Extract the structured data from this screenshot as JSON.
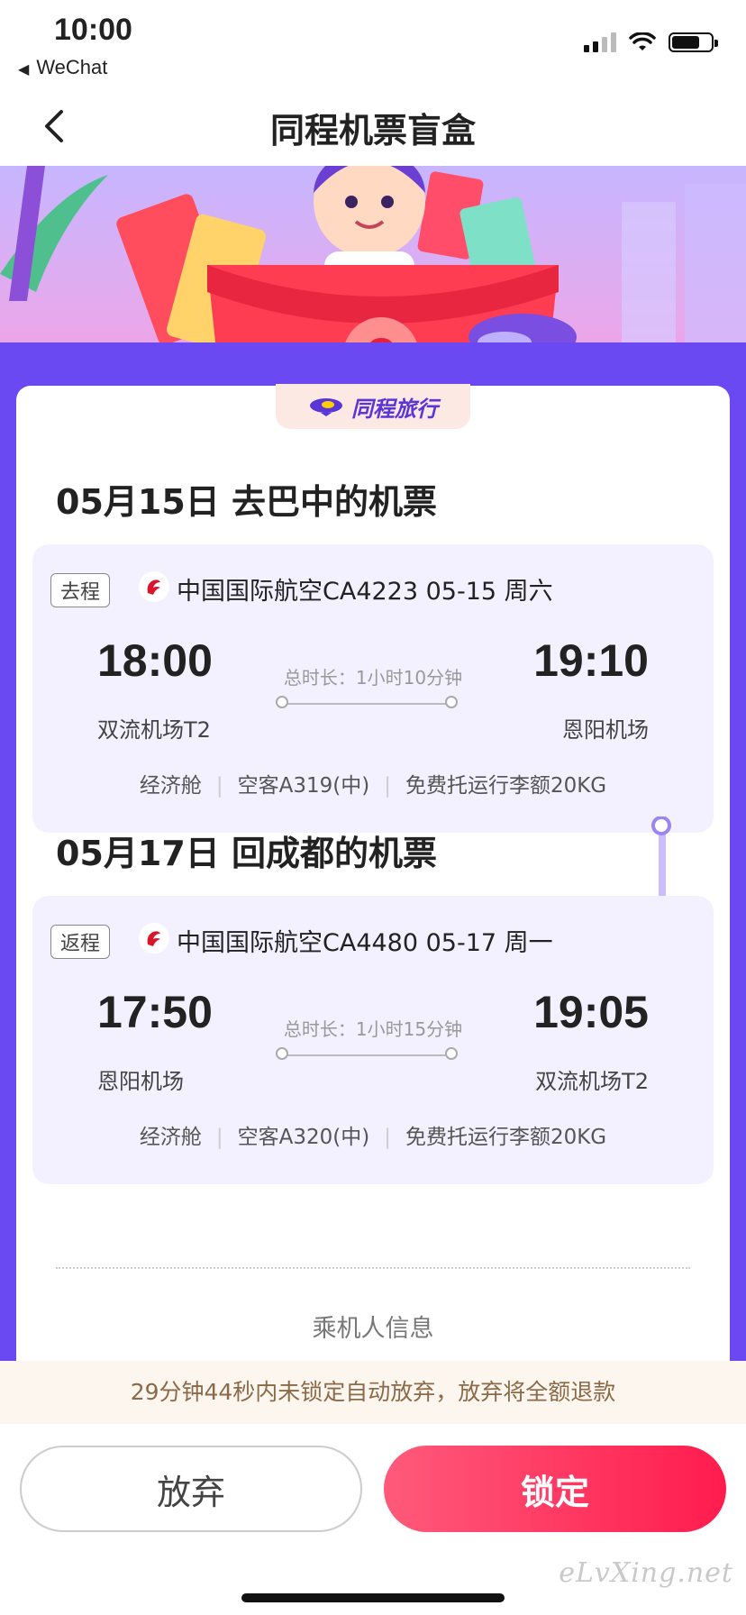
{
  "status_bar": {
    "time": "10:00",
    "back_app": "WeChat"
  },
  "nav": {
    "title": "同程机票盲盒"
  },
  "brand": {
    "name": "同程旅行"
  },
  "colors": {
    "accent_purple": "#6b49f2",
    "lock_button": "#ff1c4e",
    "notice_text": "#8a6a48"
  },
  "outbound": {
    "section_title": "05月15日 去巴中的机票",
    "direction": "去程",
    "airline_info": "中国国际航空CA4223  05-15 周六",
    "dep_time": "18:00",
    "dep_airport": "双流机场T2",
    "arr_time": "19:10",
    "arr_airport": "恩阳机场",
    "duration": "总时长：1小时10分钟",
    "cabin": "经济舱",
    "aircraft": "空客A319(中)",
    "baggage": "免费托运行李额20KG"
  },
  "return": {
    "section_title": "05月17日 回成都的机票",
    "direction": "返程",
    "airline_info": "中国国际航空CA4480  05-17 周一",
    "dep_time": "17:50",
    "dep_airport": "恩阳机场",
    "arr_time": "19:05",
    "arr_airport": "双流机场T2",
    "duration": "总时长：1小时15分钟",
    "cabin": "经济舱",
    "aircraft": "空客A320(中)",
    "baggage": "免费托运行李额20KG"
  },
  "passenger_section": "乘机人信息",
  "notice": "29分钟44秒内未锁定自动放弃，放弃将全额退款",
  "buttons": {
    "abandon": "放弃",
    "lock": "锁定"
  },
  "watermark": "eLvXing.net"
}
